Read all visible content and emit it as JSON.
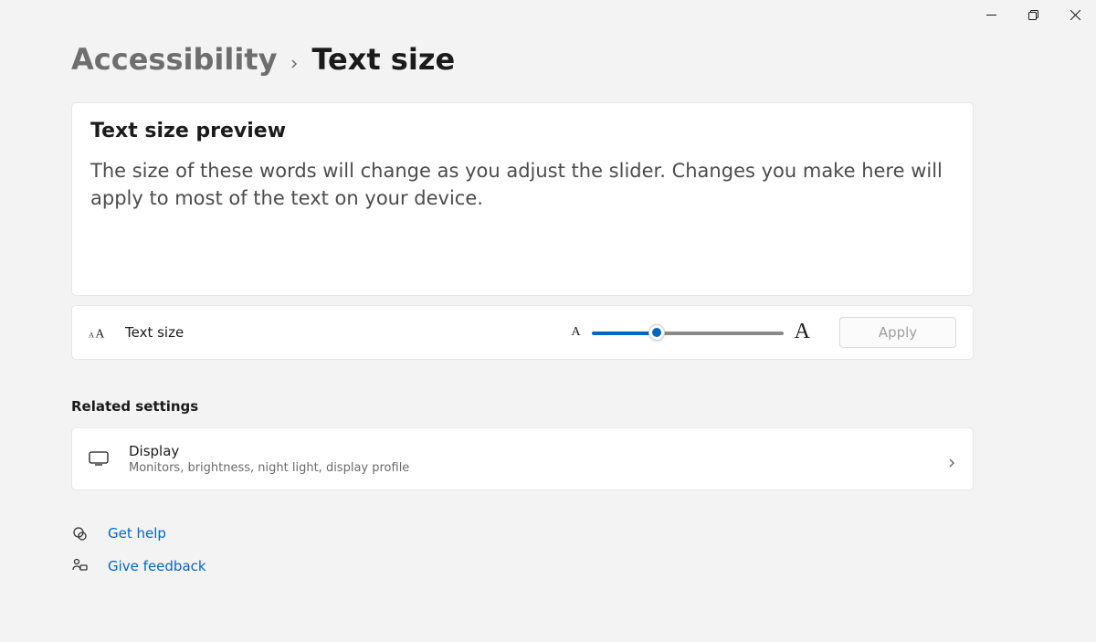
{
  "breadcrumb": {
    "parent": "Accessibility",
    "current": "Text size"
  },
  "preview": {
    "title": "Text size preview",
    "body": "The size of these words will change as you adjust the slider. Changes you make here will apply to most of the text on your device."
  },
  "text_size_row": {
    "label": "Text size",
    "small_glyph": "A",
    "large_glyph": "A",
    "slider_percent": 34,
    "apply_label": "Apply"
  },
  "related": {
    "heading": "Related settings",
    "display": {
      "title": "Display",
      "subtitle": "Monitors, brightness, night light, display profile"
    }
  },
  "links": {
    "help": "Get help",
    "feedback": "Give feedback"
  }
}
